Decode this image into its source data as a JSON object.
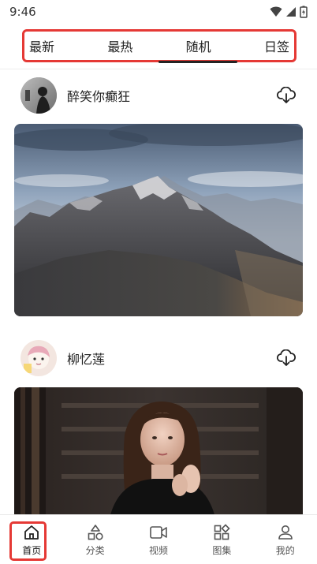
{
  "status_bar": {
    "time": "9:46"
  },
  "tabs": [
    {
      "label": "最新"
    },
    {
      "label": "最热"
    },
    {
      "label": "随机"
    },
    {
      "label": "日签"
    }
  ],
  "active_tab": "随机",
  "highlight_color": "#e53935",
  "posts": [
    {
      "username": "醉笑你癫狂",
      "avatar_icon": "avatar-dark-figure",
      "image": "mountain-landscape",
      "action_icon": "cloud-download-icon"
    },
    {
      "username": "柳忆莲",
      "avatar_icon": "avatar-cartoon-girl",
      "image": "woman-portrait-stairs",
      "action_icon": "cloud-download-icon"
    }
  ],
  "bottom_nav": [
    {
      "label": "首页",
      "icon": "home-icon"
    },
    {
      "label": "分类",
      "icon": "category-icon"
    },
    {
      "label": "视频",
      "icon": "video-icon"
    },
    {
      "label": "图集",
      "icon": "gallery-icon"
    },
    {
      "label": "我的",
      "icon": "profile-icon"
    }
  ],
  "active_nav": "首页"
}
